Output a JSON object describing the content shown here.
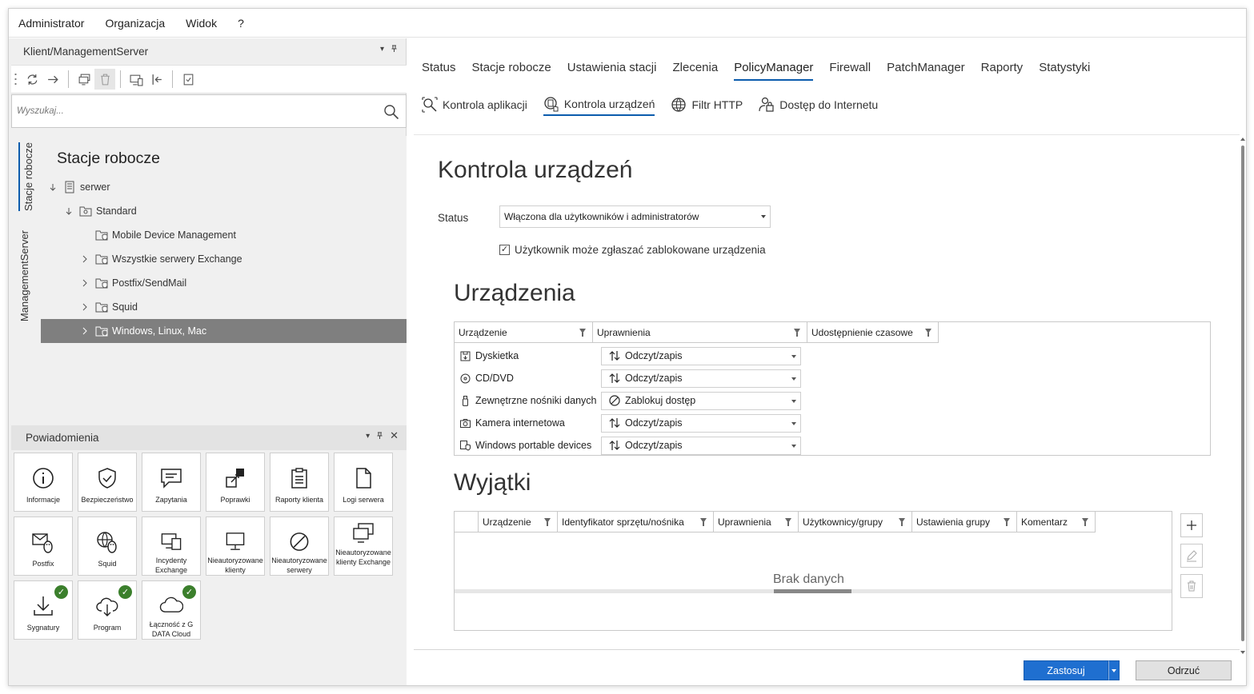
{
  "menu": [
    "Administrator",
    "Organizacja",
    "Widok",
    "?"
  ],
  "left_panel": {
    "title": "Klient/ManagementServer",
    "search_placeholder": "Wyszukaj...",
    "vertical_tabs": [
      "Stacje robocze",
      "ManagementServer"
    ],
    "tree_title": "Stacje robocze",
    "tree": [
      {
        "label": "serwer",
        "level": 0,
        "expander": "down"
      },
      {
        "label": "Standard",
        "level": 1,
        "expander": "down"
      },
      {
        "label": "Mobile Device Management",
        "level": 2,
        "expander": "none"
      },
      {
        "label": "Wszystkie serwery Exchange",
        "level": 2,
        "expander": "right"
      },
      {
        "label": "Postfix/SendMail",
        "level": 2,
        "expander": "right"
      },
      {
        "label": "Squid",
        "level": 2,
        "expander": "right"
      },
      {
        "label": "Windows, Linux, Mac",
        "level": 2,
        "expander": "right",
        "selected": true
      }
    ]
  },
  "notifications": {
    "title": "Powiadomienia",
    "tiles": [
      {
        "label": "Informacje",
        "icon": "info-icon"
      },
      {
        "label": "Bezpieczeństwo",
        "icon": "shield-icon"
      },
      {
        "label": "Zapytania",
        "icon": "chat-icon"
      },
      {
        "label": "Poprawki",
        "icon": "patch-icon"
      },
      {
        "label": "Raporty klienta",
        "icon": "clipboard-icon"
      },
      {
        "label": "Logi serwera",
        "icon": "document-icon"
      },
      {
        "label": "Postfix",
        "icon": "mail-linux-icon"
      },
      {
        "label": "Squid",
        "icon": "globe-linux-icon"
      },
      {
        "label": "Incydenty Exchange",
        "icon": "monitors-icon"
      },
      {
        "label": "Nieautoryzowane klienty",
        "icon": "monitor-icon"
      },
      {
        "label": "Nieautoryzowane serwery",
        "icon": "blocked-icon"
      },
      {
        "label": "Nieautoryzowane klienty Exchange",
        "icon": "monitors-icon"
      },
      {
        "label": "Sygnatury",
        "icon": "download-icon",
        "checked": true
      },
      {
        "label": "Program",
        "icon": "cloud-download-icon",
        "checked": true
      },
      {
        "label": "Łączność z G DATA Cloud",
        "icon": "cloud-icon",
        "checked": true
      }
    ]
  },
  "right_panel": {
    "tabs": [
      "Status",
      "Stacje robocze",
      "Ustawienia stacji",
      "Zlecenia",
      "PolicyManager",
      "Firewall",
      "PatchManager",
      "Raporty",
      "Statystyki"
    ],
    "active_tab": "PolicyManager",
    "subtabs": [
      "Kontrola aplikacji",
      "Kontrola urządzeń",
      "Filtr HTTP",
      "Dostęp do Internetu"
    ],
    "active_subtab": "Kontrola urządzeń",
    "heading": "Kontrola urządzeń",
    "status_label": "Status",
    "status_value": "Włączona dla użytkowników i administratorów",
    "checkbox_label": "Użytkownik może zgłaszać zablokowane urządzenia",
    "checkbox_checked": true,
    "devices_heading": "Urządzenia",
    "devices_columns": [
      "Urządzenie",
      "Uprawnienia",
      "Udostępnienie czasowe"
    ],
    "devices": [
      {
        "name": "Dyskietka",
        "permission": "Odczyt/zapis",
        "perm_icon": "read-write-icon"
      },
      {
        "name": "CD/DVD",
        "permission": "Odczyt/zapis",
        "perm_icon": "read-write-icon"
      },
      {
        "name": "Zewnętrzne nośniki danych",
        "permission": "Zablokuj dostęp",
        "perm_icon": "block-icon"
      },
      {
        "name": "Kamera internetowa",
        "permission": "Odczyt/zapis",
        "perm_icon": "read-write-icon"
      },
      {
        "name": "Windows portable devices",
        "permission": "Odczyt/zapis",
        "perm_icon": "read-write-icon"
      }
    ],
    "exceptions_heading": "Wyjątki",
    "exceptions_columns": [
      "Urządzenie",
      "Identyfikator sprzętu/nośnika",
      "Uprawnienia",
      "Użytkownicy/grupy",
      "Ustawienia grupy",
      "Komentarz"
    ],
    "no_data": "Brak danych",
    "apply_label": "Zastosuj",
    "cancel_label": "Odrzuć"
  },
  "colors": {
    "accent": "#0b5cad",
    "apply_button": "#1f6fd0",
    "selected_row": "#7f7f7f",
    "check_badge": "#3b7f2c"
  }
}
